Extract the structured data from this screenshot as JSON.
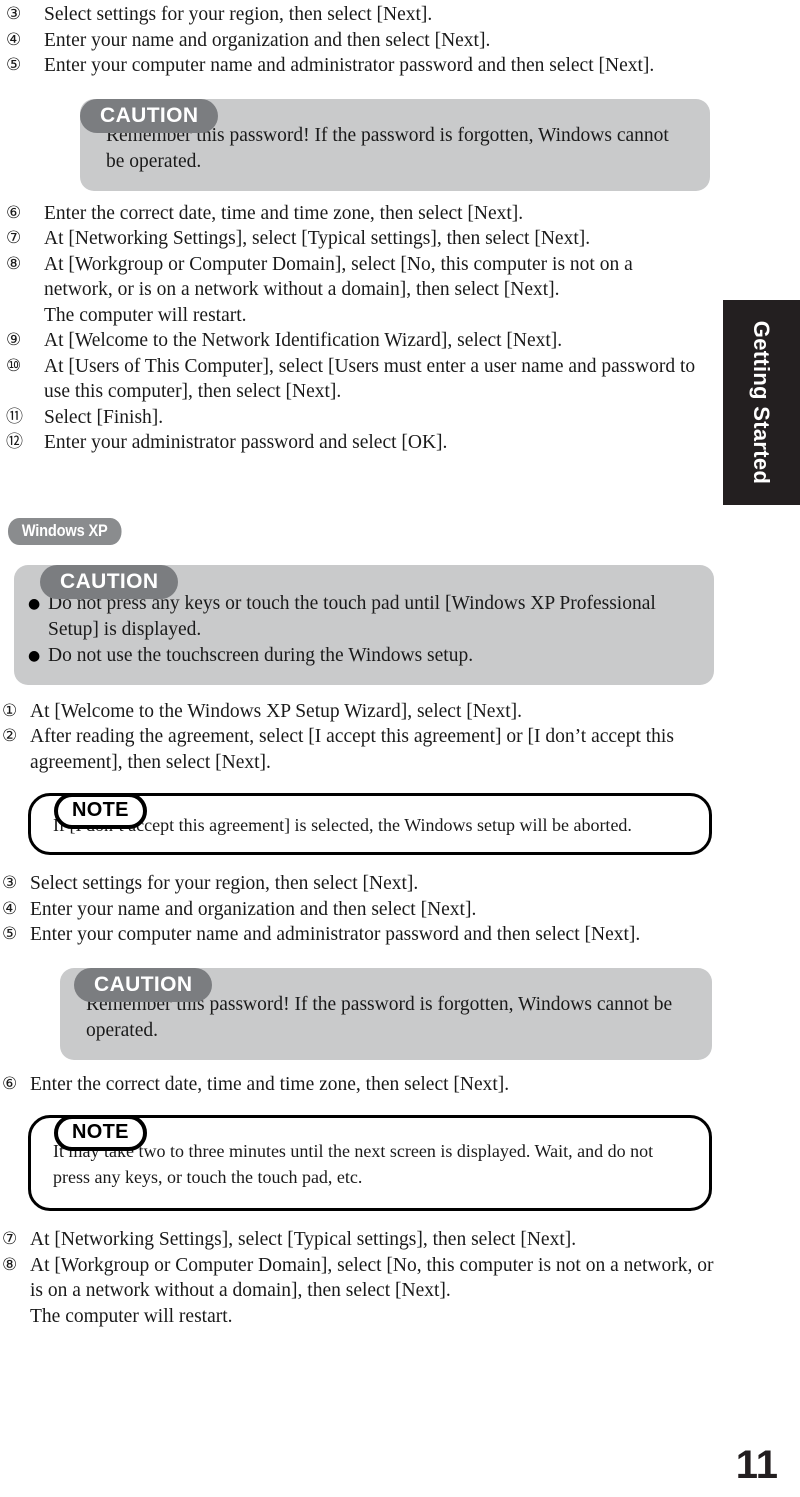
{
  "page": {
    "number": "11",
    "chapter_tab": "Getting Started"
  },
  "section_a": {
    "steps": [
      {
        "marker": "③",
        "text": "Select settings for your region, then select [Next]."
      },
      {
        "marker": "④",
        "text": "Enter your name and organization and then select [Next]."
      },
      {
        "marker": "⑤",
        "text": "Enter your computer name and administrator password and then select [Next]."
      }
    ],
    "caution": {
      "title": "CAUTION",
      "text": "Remember this password!  If the password is forgotten, Windows cannot be operated."
    },
    "steps_after": [
      {
        "marker": "⑥",
        "text": "Enter the correct date, time and time zone, then select [Next]."
      },
      {
        "marker": "⑦",
        "text": "At [Networking Settings], select [Typical settings], then select [Next]."
      },
      {
        "marker": "⑧",
        "text": "At [Workgroup or Computer Domain], select [No, this computer is not on a network, or is on a network without a domain], then select [Next].",
        "sub": "The computer will restart."
      },
      {
        "marker": "⑨",
        "text": "At [Welcome to the Network Identification Wizard], select [Next]."
      },
      {
        "marker": "⑩",
        "text": "At [Users of This Computer], select [Users must enter a user name and password to use this computer], then select [Next]."
      },
      {
        "marker": "⑪",
        "text": "Select [Finish]."
      },
      {
        "marker": "⑫",
        "text": "Enter your administrator password and select [OK]."
      }
    ]
  },
  "section_b": {
    "os_badge": "Windows XP",
    "caution_top": {
      "title": "CAUTION",
      "bullets": [
        {
          "dot": "●",
          "text": "Do not press any keys or touch the touch pad until [Windows XP Professional Setup] is displayed."
        },
        {
          "dot": "●",
          "text": "Do not use the touchscreen during the Windows setup."
        }
      ]
    },
    "steps_1_2": [
      {
        "marker": "①",
        "text": "At [Welcome to the Windows XP Setup Wizard], select [Next]."
      },
      {
        "marker": "②",
        "text": "After reading the agreement, select [I accept this agreement] or [I don’t accept this agreement], then select [Next]."
      }
    ],
    "note_1": {
      "title": "NOTE",
      "text": "If [I don’t accept this agreement] is selected, the Windows setup will be aborted."
    },
    "steps_3_5": [
      {
        "marker": "③",
        "text": "Select settings for your region, then select [Next]."
      },
      {
        "marker": "④",
        "text": "Enter your name and organization and then select [Next]."
      },
      {
        "marker": "⑤",
        "text": "Enter your computer name and administrator password and then select [Next]."
      }
    ],
    "caution_bottom": {
      "title": "CAUTION",
      "text": "Remember this password!  If the password is forgotten, Windows cannot be operated."
    },
    "step_6": {
      "marker": "⑥",
      "text": "Enter the correct date, time and time zone, then select [Next]."
    },
    "note_2": {
      "title": "NOTE",
      "text": "It may take two to three minutes until the next screen is displayed.  Wait, and do not press any keys, or touch the touch pad, etc."
    },
    "steps_7_8": [
      {
        "marker": "⑦",
        "text": "At [Networking Settings], select [Typical settings], then select [Next]."
      },
      {
        "marker": "⑧",
        "text": "At [Workgroup or Computer Domain], select [No, this computer is not on a network, or is on a network without a domain], then select [Next].",
        "sub": "The computer will restart."
      }
    ]
  },
  "colors": {
    "caution_tab": "#7b7d80",
    "caution_body": "#c9cacb",
    "os_badge": "#8a8c8e",
    "tab_black": "#231f20"
  }
}
